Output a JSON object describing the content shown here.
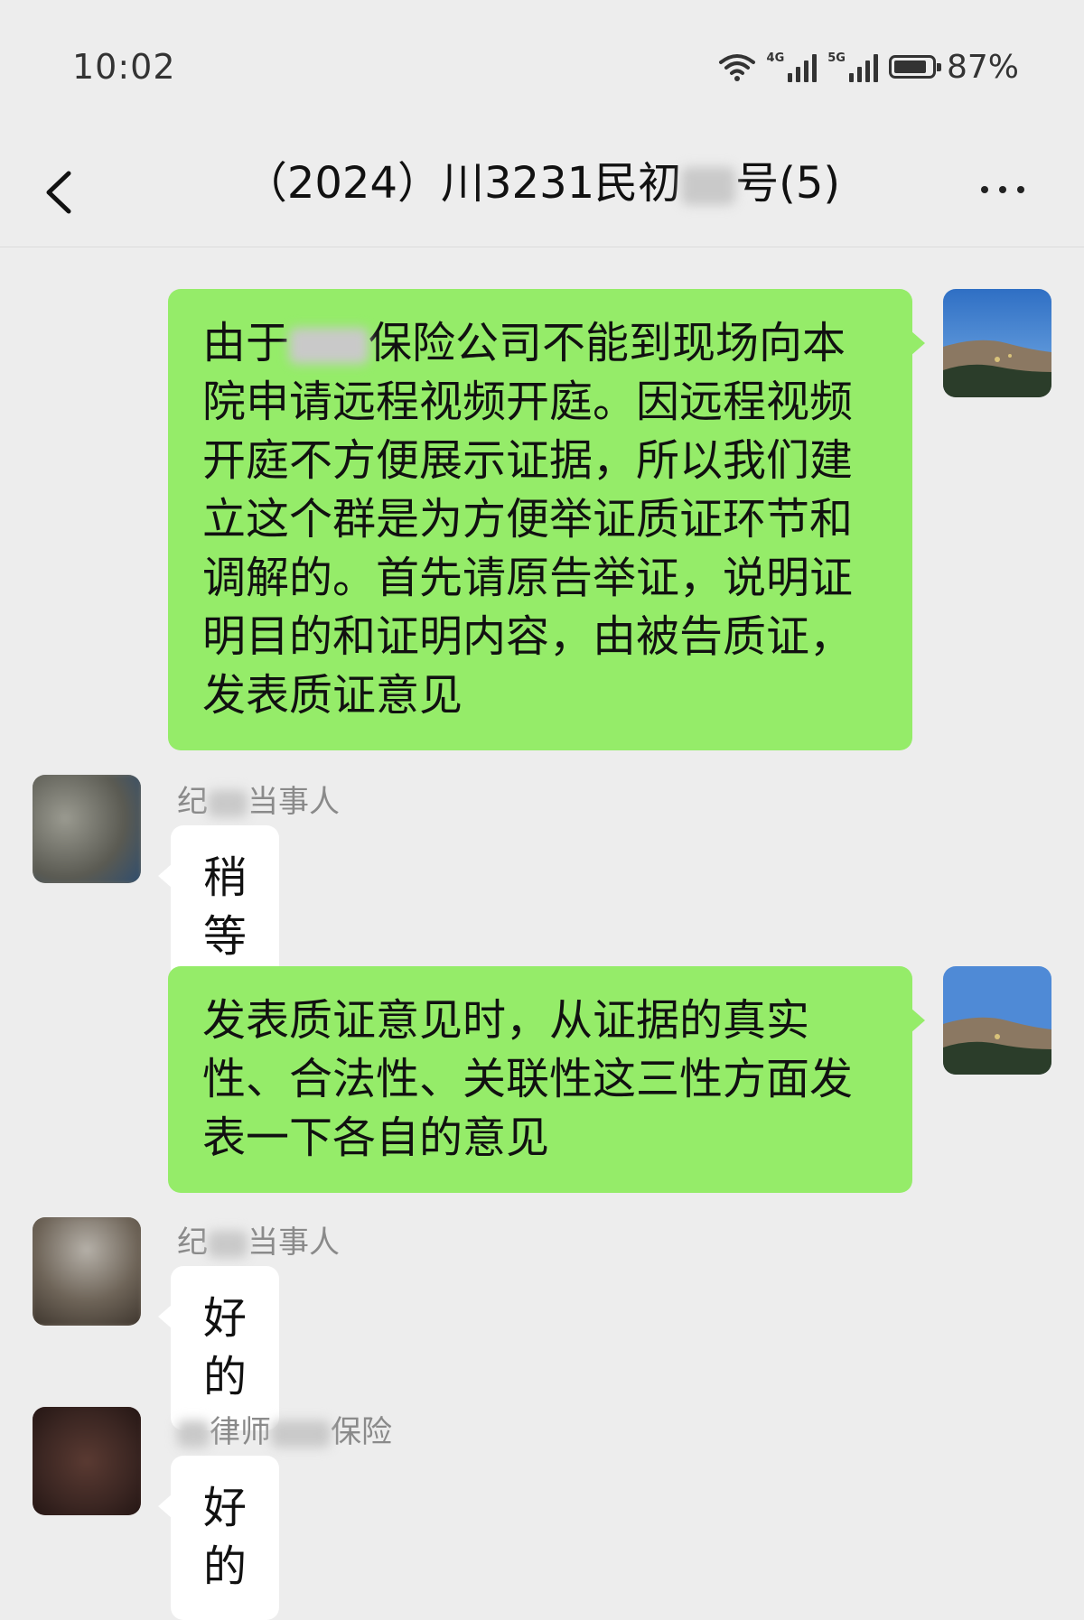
{
  "status_bar": {
    "time": "10:02",
    "network_1": "4G",
    "network_2": "5G",
    "battery_level": 0.87,
    "battery_text": "87%"
  },
  "nav": {
    "title": "（2024）川3231民初",
    "title_suffix": "号(5)",
    "back_icon": "chevron-left-icon",
    "more_icon": "more-dots-icon"
  },
  "messages": [
    {
      "side": "right",
      "text_prefix": "由于",
      "text": "保险公司不能到现场向本院申请远程视频开庭。因远程视频开庭不方便展示证据，所以我们建立这个群是为方便举证质证环节和调解的。首先请原告举证，说明证明目的和证明内容，由被告质证，发表质证意见"
    },
    {
      "side": "left",
      "sender_prefix": "纪",
      "sender": "当事人",
      "text": "稍等"
    },
    {
      "side": "right",
      "text": "发表质证意见时，从证据的真实性、合法性、关联性这三性方面发表一下各自的意见"
    },
    {
      "side": "left",
      "sender_prefix": "纪",
      "sender": "当事人",
      "text": "好的"
    },
    {
      "side": "left",
      "sender_prefix": "律师",
      "sender": "保险",
      "text": "好的"
    }
  ],
  "colors": {
    "background": "#ededed",
    "my_bubble": "#95ec69",
    "their_bubble": "#ffffff"
  }
}
